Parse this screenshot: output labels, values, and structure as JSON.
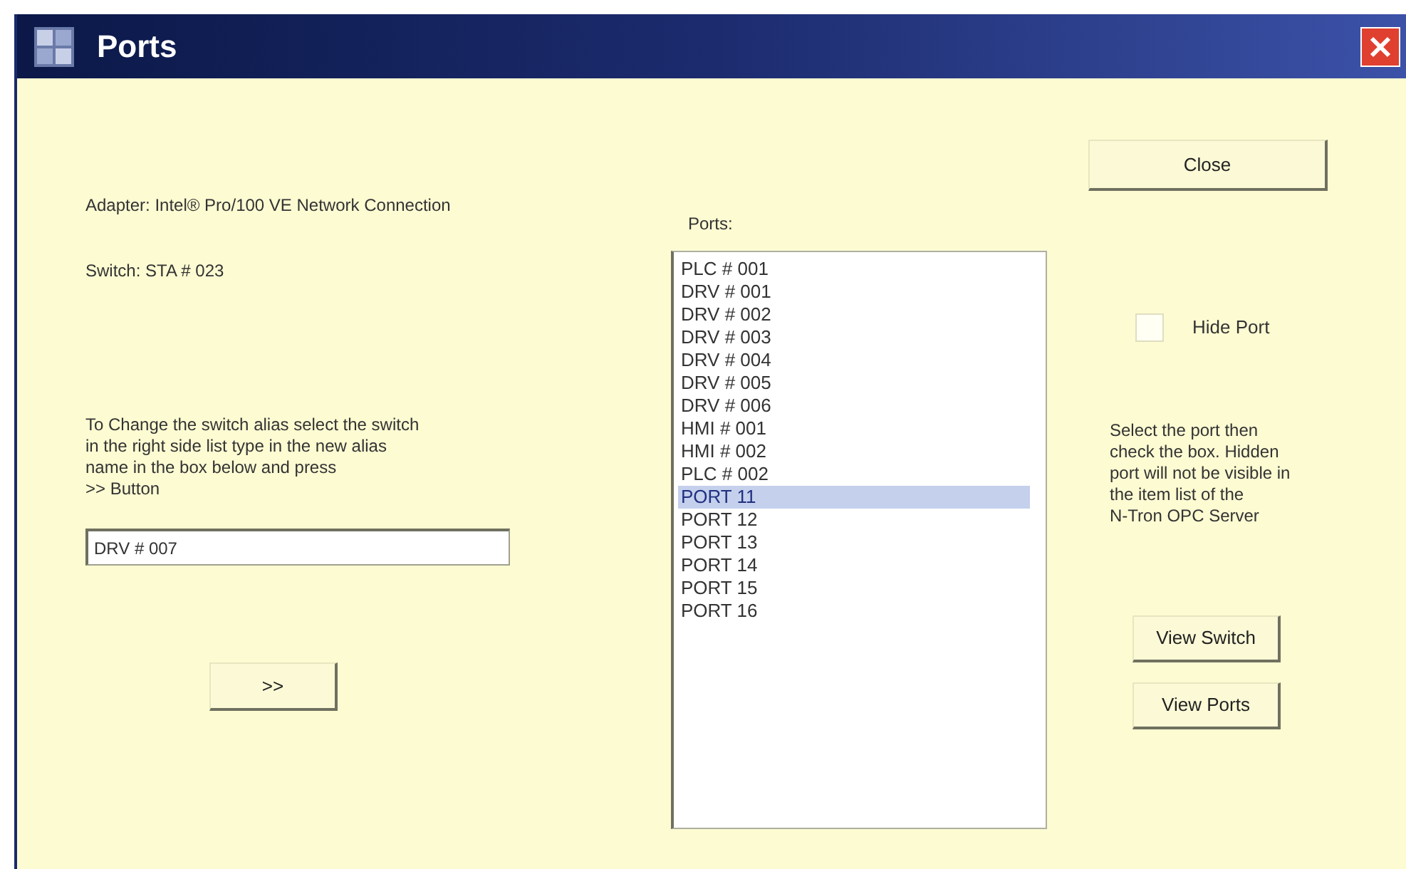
{
  "window": {
    "title": "Ports"
  },
  "adapter": "Adapter:  Intel® Pro/100 VE Network Connection",
  "switch": "Switch: STA # 023",
  "instructions": "To Change the switch alias select the switch\nin the right side list type in the new alias\nname in the box below and press\n>> Button",
  "alias_field": {
    "value": "DRV # 007"
  },
  "apply_button": ">>",
  "ports_label": "Ports:",
  "ports": [
    {
      "label": "PLC  # 001",
      "selected": false
    },
    {
      "label": "DRV # 001",
      "selected": false
    },
    {
      "label": "DRV # 002",
      "selected": false
    },
    {
      "label": "DRV # 003",
      "selected": false
    },
    {
      "label": "DRV # 004",
      "selected": false
    },
    {
      "label": "DRV # 005",
      "selected": false
    },
    {
      "label": "DRV # 006",
      "selected": false
    },
    {
      "label": "HMI # 001",
      "selected": false
    },
    {
      "label": "HMI # 002",
      "selected": false
    },
    {
      "label": "PLC # 002",
      "selected": false
    },
    {
      "label": "PORT 11",
      "selected": true
    },
    {
      "label": "PORT 12",
      "selected": false
    },
    {
      "label": "PORT 13",
      "selected": false
    },
    {
      "label": "PORT 14",
      "selected": false
    },
    {
      "label": "PORT 15",
      "selected": false
    },
    {
      "label": "PORT 16",
      "selected": false
    }
  ],
  "close_button": "Close",
  "hide_port": {
    "label": "Hide Port",
    "checked": false
  },
  "note": "Select the port then\ncheck the box. Hidden\nport will not be visible in\nthe item list of the\nN-Tron OPC Server",
  "buttons": [
    "View Switch",
    "View Ports"
  ]
}
